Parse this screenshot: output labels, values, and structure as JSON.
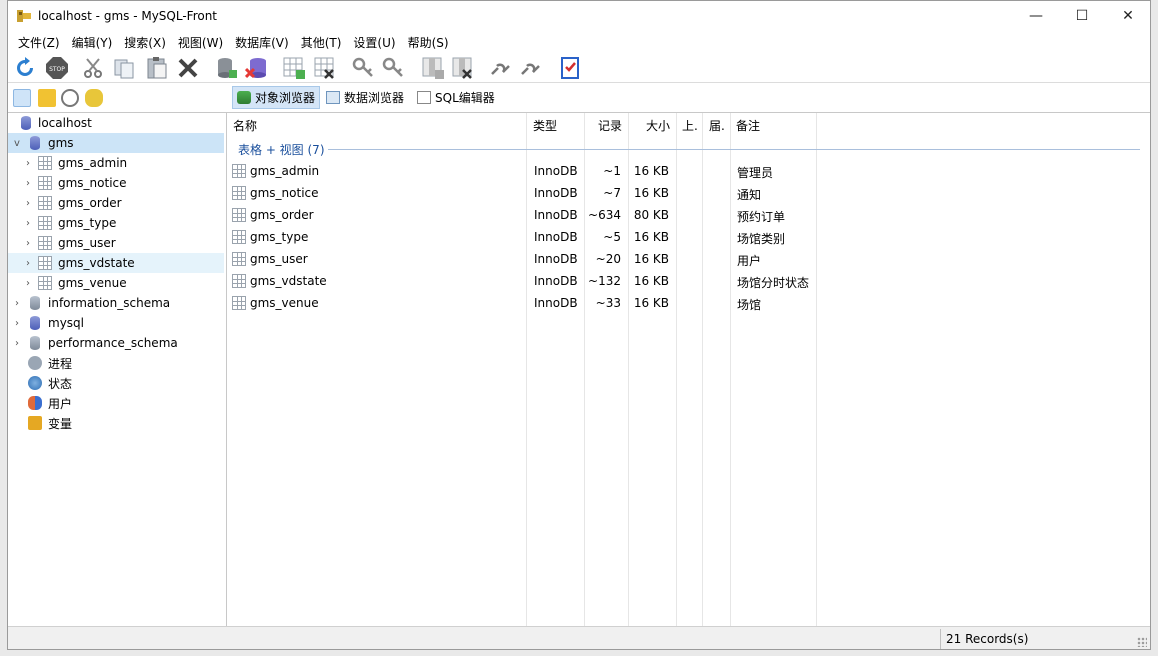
{
  "window": {
    "title": "localhost - gms - MySQL-Front",
    "minimize": "—",
    "maximize": "☐",
    "close": "✕"
  },
  "menu": [
    "文件(Z)",
    "编辑(Y)",
    "搜索(X)",
    "视图(W)",
    "数据库(V)",
    "其他(T)",
    "设置(U)",
    "帮助(S)"
  ],
  "view_tabs": [
    "对象浏览器",
    "数据浏览器",
    "SQL编辑器"
  ],
  "tree": {
    "root": "localhost",
    "db": "gms",
    "tables": [
      "gms_admin",
      "gms_notice",
      "gms_order",
      "gms_type",
      "gms_user",
      "gms_vdstate",
      "gms_venue"
    ],
    "other_dbs": [
      "information_schema",
      "mysql",
      "performance_schema"
    ],
    "extras": [
      "进程",
      "状态",
      "用户",
      "变量"
    ]
  },
  "columns": [
    "名称",
    "类型",
    "记录",
    "大小",
    "上.",
    "届.",
    "备注"
  ],
  "group_label": "表格 + 视图 (7)",
  "rows": [
    {
      "name": "gms_admin",
      "type": "InnoDB",
      "records": "~1",
      "size": "16 KB",
      "note": "管理员"
    },
    {
      "name": "gms_notice",
      "type": "InnoDB",
      "records": "~7",
      "size": "16 KB",
      "note": "通知"
    },
    {
      "name": "gms_order",
      "type": "InnoDB",
      "records": "~634",
      "size": "80 KB",
      "note": "预约订单"
    },
    {
      "name": "gms_type",
      "type": "InnoDB",
      "records": "~5",
      "size": "16 KB",
      "note": "场馆类别"
    },
    {
      "name": "gms_user",
      "type": "InnoDB",
      "records": "~20",
      "size": "16 KB",
      "note": "用户"
    },
    {
      "name": "gms_vdstate",
      "type": "InnoDB",
      "records": "~132",
      "size": "16 KB",
      "note": "场馆分时状态"
    },
    {
      "name": "gms_venue",
      "type": "InnoDB",
      "records": "~33",
      "size": "16 KB",
      "note": "场馆"
    }
  ],
  "status": {
    "records": "21 Records(s)"
  },
  "colors": {
    "selection": "#cce4f7",
    "accent": "#1a4f9c"
  }
}
